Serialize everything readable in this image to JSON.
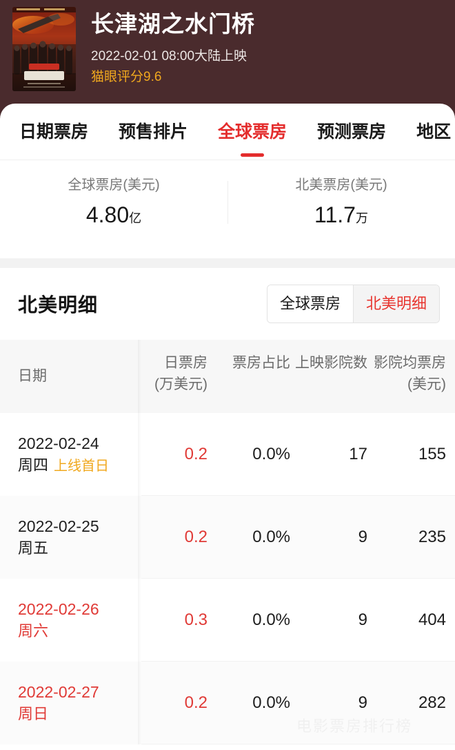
{
  "theme": {
    "hero_bg": "#4a2b2d",
    "accent_red": "#e42d2d",
    "accent_orange": "#f0a81e",
    "value_red": "#e03a36",
    "band_gray": "#f2f2f2"
  },
  "hero": {
    "poster_alt": "movie-poster",
    "title": "长津湖之水门桥",
    "release": "2022-02-01 08:00大陆上映",
    "score": "猫眼评分9.6"
  },
  "tabs": [
    {
      "label": "日期票房",
      "active": false
    },
    {
      "label": "预售排片",
      "active": false
    },
    {
      "label": "全球票房",
      "active": true
    },
    {
      "label": "预测票房",
      "active": false
    },
    {
      "label": "地区",
      "active": false
    }
  ],
  "stats": [
    {
      "label": "全球票房(美元)",
      "value": "4.80",
      "unit": "亿"
    },
    {
      "label": "北美票房(美元)",
      "value": "11.7",
      "unit": "万"
    }
  ],
  "section": {
    "title": "北美明细",
    "toggle": [
      {
        "label": "全球票房",
        "active": false
      },
      {
        "label": "北美明细",
        "active": true
      }
    ]
  },
  "table": {
    "headers": {
      "date": "日期",
      "daily": {
        "main": "日票房",
        "sub": "(万美元)"
      },
      "share": {
        "main": "票房占比",
        "sub": ""
      },
      "theaters": {
        "main": "上映影院数",
        "sub": ""
      },
      "avg": {
        "main": "影院均票房",
        "sub": "(美元)"
      }
    },
    "rows": [
      {
        "date": "2022-02-24",
        "weekday": "周四",
        "badge": "上线首日",
        "weekend": false,
        "daily": "0.2",
        "share": "0.0%",
        "theaters": "17",
        "avg": "155"
      },
      {
        "date": "2022-02-25",
        "weekday": "周五",
        "badge": "",
        "weekend": false,
        "daily": "0.2",
        "share": "0.0%",
        "theaters": "9",
        "avg": "235"
      },
      {
        "date": "2022-02-26",
        "weekday": "周六",
        "badge": "",
        "weekend": true,
        "daily": "0.3",
        "share": "0.0%",
        "theaters": "9",
        "avg": "404"
      },
      {
        "date": "2022-02-27",
        "weekday": "周日",
        "badge": "",
        "weekend": true,
        "daily": "0.2",
        "share": "0.0%",
        "theaters": "9",
        "avg": "282"
      }
    ]
  },
  "watermark": "电影票房排行榜"
}
